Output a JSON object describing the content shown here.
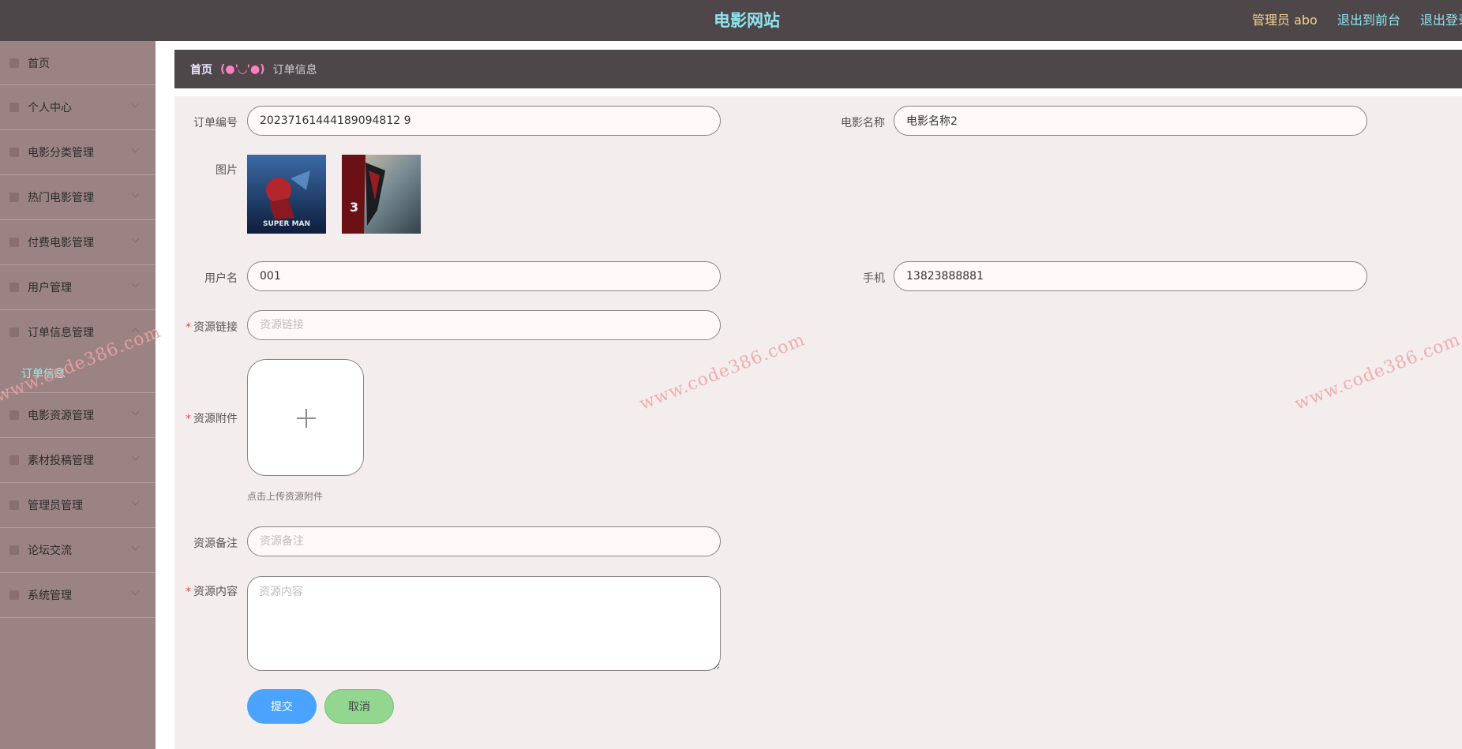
{
  "header": {
    "site_title": "电影网站",
    "admin_label": "管理员 abo",
    "links": [
      "退出到前台",
      "退出登录"
    ]
  },
  "sidebar": {
    "items": [
      {
        "label": "首页",
        "icon": "home-icon"
      },
      {
        "label": "个人中心",
        "icon": "user-icon"
      },
      {
        "label": "电影分类管理",
        "icon": "grid-icon"
      },
      {
        "label": "热门电影管理",
        "icon": "film-icon"
      },
      {
        "label": "付费电影管理",
        "icon": "card-icon"
      },
      {
        "label": "用户管理",
        "icon": "users-icon"
      },
      {
        "label": "订单信息管理",
        "icon": "order-icon"
      },
      {
        "label": "电影资源管理",
        "icon": "folder-icon"
      },
      {
        "label": "素材投稿管理",
        "icon": "upload-icon"
      },
      {
        "label": "管理员管理",
        "icon": "admin-icon"
      },
      {
        "label": "论坛交流",
        "icon": "forum-icon"
      },
      {
        "label": "系统管理",
        "icon": "settings-icon"
      }
    ],
    "active_sub": "订单信息"
  },
  "breadcrumb": {
    "home": "首页",
    "separator": "(●'◡'●)",
    "current": "订单信息"
  },
  "form": {
    "order_no_label": "订单编号",
    "order_no_value": "20237161444189094812 9",
    "movie_name_label": "电影名称",
    "movie_name_value": "电影名称2",
    "image_label": "图片",
    "username_label": "用户名",
    "username_value": "001",
    "phone_label": "手机",
    "phone_value": "13823888881",
    "resource_link_label": "资源链接",
    "resource_link_placeholder": "资源链接",
    "attachment_label": "资源附件",
    "attachment_tip": "点击上传资源附件",
    "remark_label": "资源备注",
    "remark_placeholder": "资源备注",
    "content_label": "资源内容",
    "content_placeholder": "资源内容",
    "submit_label": "提交",
    "cancel_label": "取消"
  },
  "watermark": "www.code386.com"
}
